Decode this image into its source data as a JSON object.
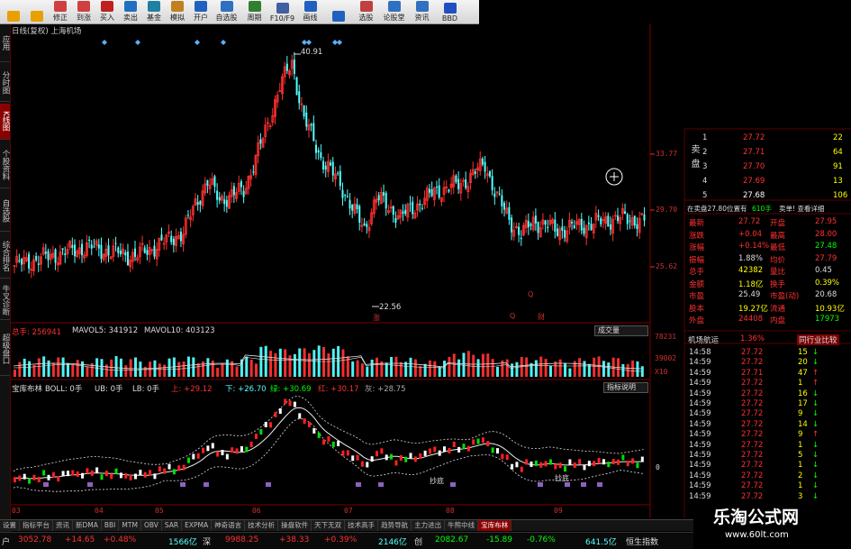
{
  "toolbar": {
    "buttons": [
      "",
      "",
      "修正",
      "到涨",
      "买入",
      "卖出",
      "基金",
      "模拟",
      "开户",
      "自选股",
      "周期",
      "F10/F9",
      "画线",
      "",
      "选股",
      "论股堂",
      "资讯",
      "BBD"
    ]
  },
  "sidebar": {
    "tabs": [
      "应用",
      "分时图",
      "K线图",
      "个股资料",
      "自选股",
      "综合排名",
      "牛叉诊断",
      "超级盘口"
    ]
  },
  "chart": {
    "header": "日线(复权)  上海机场",
    "price_high_label": "40.91",
    "price_low_label": "22.56",
    "y_labels": [
      "33.77",
      "29.70",
      "25.62"
    ],
    "volume_line": {
      "total": "总手: 256941",
      "ma5": "MAVOL5: 341912",
      "ma10": "MAVOL10: 403123"
    },
    "volume_button": "成交量",
    "volume_labels": [
      "78231",
      "39002",
      "X10"
    ],
    "boll_line": {
      "name": "宝库布林",
      "boll": "BOLL: 0手",
      "ub": "UB: 0手",
      "lb": "LB: 0手",
      "up": "上: +29.12",
      "down": "下: +26.70",
      "green": "绿: +30.69",
      "red": "红: +30.17",
      "gray": "灰: +28.75"
    },
    "boll_button": "指标说明",
    "boll_zero": "0",
    "x_labels": [
      "03",
      "04",
      "05",
      "06",
      "07",
      "08",
      "09"
    ],
    "annotations": [
      "涨",
      "Q",
      "财",
      "Q"
    ],
    "boll_notes": [
      "抄底",
      "抄底"
    ]
  },
  "chart_data": {
    "type": "candlestick",
    "title": "上海机场",
    "high": 40.91,
    "low": 22.56,
    "y_ticks": [
      25.62,
      29.7,
      33.77
    ],
    "x_ticks": [
      "03",
      "04",
      "05",
      "06",
      "07",
      "08",
      "09"
    ]
  },
  "order_book": {
    "sell_label": "卖盘",
    "sell": [
      {
        "level": "1",
        "price": "27.72",
        "vol": "22"
      },
      {
        "level": "2",
        "price": "27.71",
        "vol": "64"
      },
      {
        "level": "3",
        "price": "27.70",
        "vol": "91"
      },
      {
        "level": "4",
        "price": "27.69",
        "vol": "13"
      },
      {
        "level": "5",
        "price": "27.68",
        "vol": "106"
      }
    ],
    "summary": "在卖盘27.80位置有",
    "summary_vol": "610手",
    "summary_tail": "卖单! 查看详细"
  },
  "quote": {
    "rows": [
      {
        "l1": "最新",
        "v1": "27.72",
        "l2": "开盘",
        "v2": "27.95"
      },
      {
        "l1": "涨跌",
        "v1": "+0.04",
        "l2": "最高",
        "v2": "28.00"
      },
      {
        "l1": "涨幅",
        "v1": "+0.14%",
        "l2": "最低",
        "v2": "27.48"
      },
      {
        "l1": "振幅",
        "v1": "1.88%",
        "l2": "均价",
        "v2": "27.79"
      },
      {
        "l1": "总手",
        "v1": "42382",
        "l2": "量比",
        "v2": "0.45"
      },
      {
        "l1": "金额",
        "v1": "1.18亿",
        "l2": "换手",
        "v2": "0.39%"
      },
      {
        "l1": "市盈",
        "v1": "25.49",
        "l2": "市盈(动)",
        "v2": "20.68"
      },
      {
        "l1": "股本",
        "v1": "19.27亿",
        "l2": "流通",
        "v2": "10.93亿"
      },
      {
        "l1": "外盘",
        "v1": "24408",
        "l2": "内盘",
        "v2": "17973"
      }
    ]
  },
  "trades": {
    "tab1": "机场航运",
    "tab1_pct": "1.36%",
    "tab2": "同行业比较",
    "rows": [
      {
        "time": "14:58",
        "price": "27.72",
        "vol": "15"
      },
      {
        "time": "14:59",
        "price": "27.72",
        "vol": "20"
      },
      {
        "time": "14:59",
        "price": "27.71",
        "vol": "47"
      },
      {
        "time": "14:59",
        "price": "27.72",
        "vol": "1"
      },
      {
        "time": "14:59",
        "price": "27.72",
        "vol": "16"
      },
      {
        "time": "14:59",
        "price": "27.72",
        "vol": "17"
      },
      {
        "time": "14:59",
        "price": "27.72",
        "vol": "9"
      },
      {
        "time": "14:59",
        "price": "27.72",
        "vol": "14"
      },
      {
        "time": "14:59",
        "price": "27.72",
        "vol": "9"
      },
      {
        "time": "14:59",
        "price": "27.72",
        "vol": "1"
      },
      {
        "time": "14:59",
        "price": "27.72",
        "vol": "5"
      },
      {
        "time": "14:59",
        "price": "27.72",
        "vol": "1"
      },
      {
        "time": "14:59",
        "price": "27.72",
        "vol": "2"
      },
      {
        "time": "14:59",
        "price": "27.72",
        "vol": "1"
      },
      {
        "time": "14:59",
        "price": "27.72",
        "vol": "3"
      }
    ]
  },
  "bottom_tabs": [
    "设置",
    "指标平台",
    "资讯",
    "新DMA",
    "BBI",
    "MTM",
    "OBV",
    "SAR",
    "EXPMA",
    "神奇语言",
    "技术分析",
    "操盘软件",
    "天下无双",
    "技术高手",
    "趋势导航",
    "主力进出",
    "牛熊中线",
    "宝库布林"
  ],
  "status": {
    "a": "户",
    "b": "3052.78",
    "c": "+14.65",
    "d": "+0.48%",
    "e": "1566亿",
    "f": "深",
    "g": "9988.25",
    "h": "+38.33",
    "i": "+0.39%",
    "j": "2146亿",
    "k": "创",
    "l": "2082.67",
    "m": "-15.89",
    "n": "-0.76%",
    "o": "641.5亿",
    "p": "恒生指数"
  },
  "watermark": {
    "title": "乐淘公式网",
    "url": "www.60lt.com"
  },
  "colors": {
    "up": "#ff3030",
    "down": "#54ffff",
    "text_yellow": "#ffff00",
    "text_green": "#00ff00",
    "axis_red": "#d03030"
  }
}
